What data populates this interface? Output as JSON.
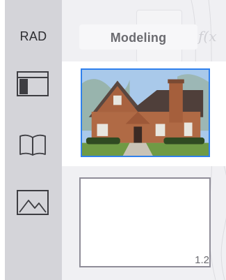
{
  "sidebar": {
    "mode_label": "RAD",
    "icons": [
      "layout-panel-icon",
      "book-icon",
      "image-icon"
    ]
  },
  "header": {
    "title": "Modeling"
  },
  "slides": {
    "thumbnail_1": {
      "content": "house-photo",
      "selected": true
    },
    "thumbnail_2": {
      "number": "1.2"
    }
  },
  "colors": {
    "selection": "#2f80ed",
    "sidebar_bg": "#d4d4d9"
  }
}
